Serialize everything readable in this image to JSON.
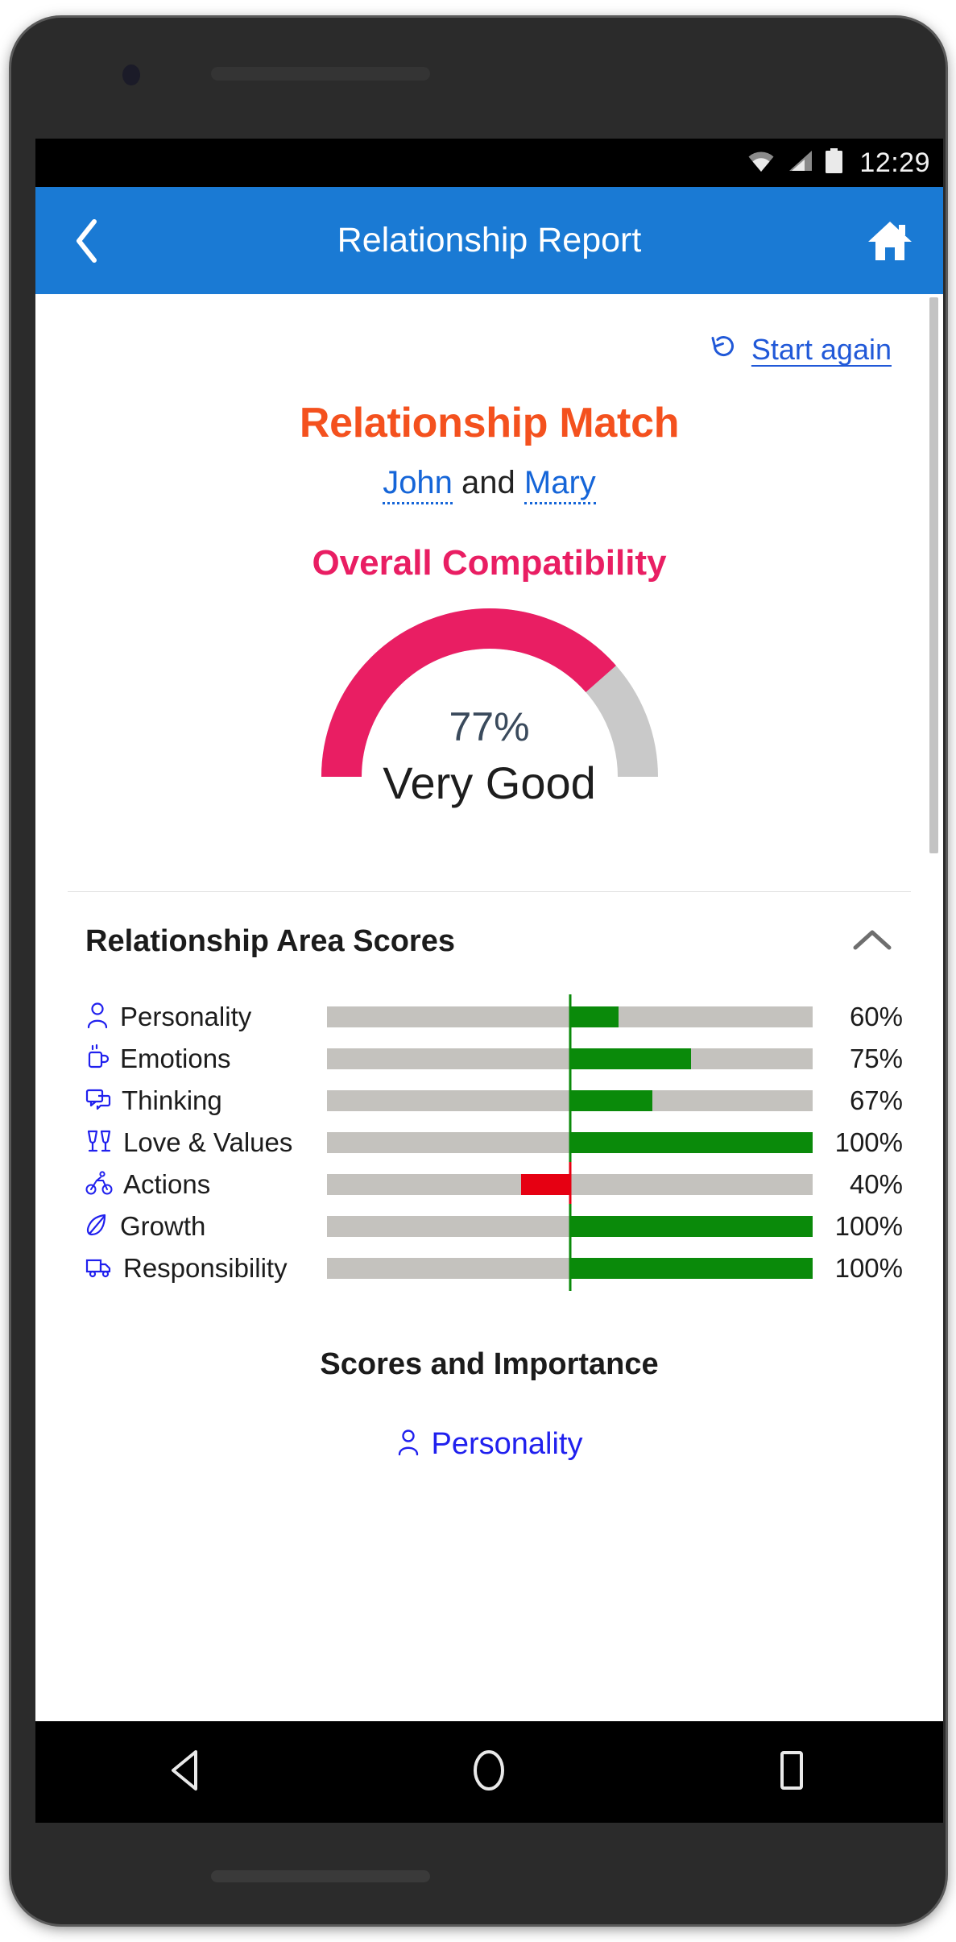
{
  "status_bar": {
    "clock": "12:29",
    "icons": [
      "wifi-icon",
      "cellular-signal-icon",
      "battery-icon"
    ]
  },
  "app_bar": {
    "title": "Relationship Report",
    "back_icon": "chevron-left-icon",
    "home_icon": "home-icon"
  },
  "content": {
    "start_again": {
      "label": "Start again",
      "icon": "rotate-ccw-icon"
    },
    "match_title": "Relationship Match",
    "couple": {
      "person_a": "John",
      "conjunction": " and ",
      "person_b": "Mary"
    },
    "compatibility": {
      "title": "Overall Compatibility",
      "percent_label": "77%",
      "rating": "Very Good",
      "value": 77,
      "arc_color": "#e91e63",
      "track_color": "#c9c9c9"
    },
    "area_scores": {
      "title": "Relationship Area Scores",
      "collapse_icon": "chevron-up-icon",
      "rows": [
        {
          "icon": "person-icon",
          "label": "Personality",
          "value": 60,
          "value_label": "60%",
          "direction": "positive"
        },
        {
          "icon": "mug-icon",
          "label": "Emotions",
          "value": 75,
          "value_label": "75%",
          "direction": "positive"
        },
        {
          "icon": "chat-bubbles-icon",
          "label": "Thinking",
          "value": 67,
          "value_label": "67%",
          "direction": "positive"
        },
        {
          "icon": "cheers-glasses-icon",
          "label": "Love & Values",
          "value": 100,
          "value_label": "100%",
          "direction": "positive"
        },
        {
          "icon": "bicycle-icon",
          "label": "Actions",
          "value": 40,
          "value_label": "40%",
          "direction": "negative"
        },
        {
          "icon": "leaf-icon",
          "label": "Growth",
          "value": 100,
          "value_label": "100%",
          "direction": "positive"
        },
        {
          "icon": "truck-icon",
          "label": "Responsibility",
          "value": 100,
          "value_label": "100%",
          "direction": "positive"
        }
      ]
    },
    "scores_importance": {
      "title": "Scores and Importance",
      "first_item": {
        "icon": "person-icon",
        "label": "Personality"
      }
    }
  },
  "nav_bar": {
    "back_icon": "triangle-back-icon",
    "home_icon": "circle-home-icon",
    "recents_icon": "square-recents-icon"
  },
  "chart_data": {
    "type": "bar",
    "title": "Relationship Area Scores",
    "categories": [
      "Personality",
      "Emotions",
      "Thinking",
      "Love & Values",
      "Actions",
      "Growth",
      "Responsibility"
    ],
    "values": [
      60,
      75,
      67,
      100,
      40,
      100,
      100
    ],
    "value_labels": [
      "60%",
      "75%",
      "67%",
      "100%",
      "40%",
      "100%",
      "100%"
    ],
    "directions": [
      "positive",
      "positive",
      "positive",
      "positive",
      "negative",
      "positive",
      "positive"
    ],
    "xlabel": "",
    "ylabel": "",
    "xlim": [
      0,
      100
    ],
    "grid": false,
    "legend": "none",
    "positive_color": "#0a8a0a",
    "negative_color": "#e60012",
    "track_color": "#c4c2be",
    "notes": "Diverging bar: midline at bar center; positive scores grow right in green, negative scores grow left in red."
  }
}
